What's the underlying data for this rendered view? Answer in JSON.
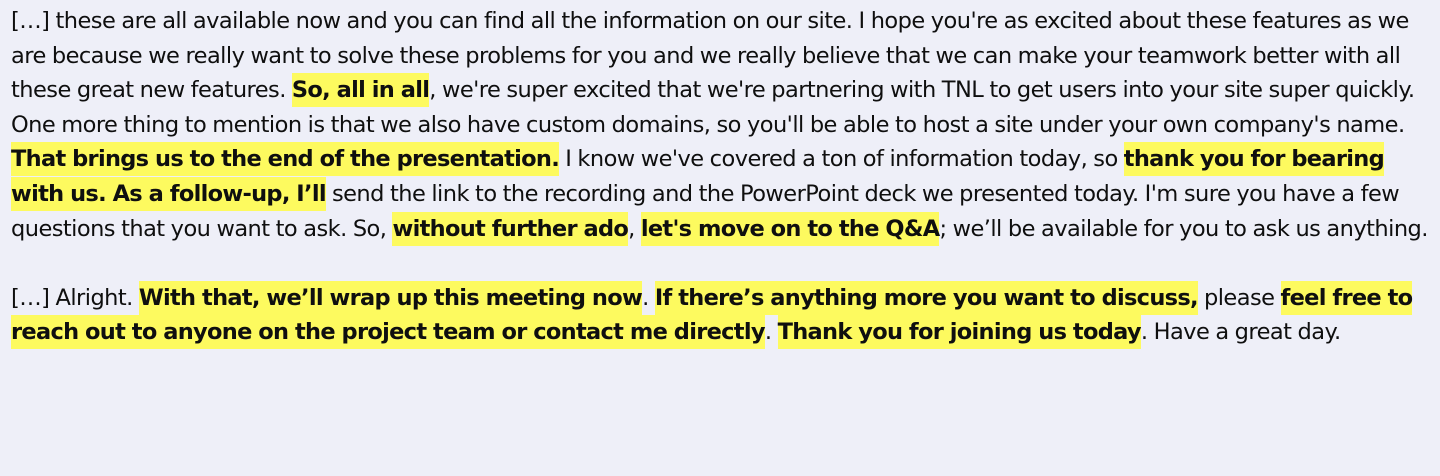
{
  "transcript": {
    "paragraphs": [
      {
        "segments": [
          {
            "text": "[…] these are all available now and you can find all the information on our site. I hope you're as excited about these features as we are because we really want to solve these problems for you and we really believe that we can make your teamwork better with all these great new features. ",
            "highlight": false
          },
          {
            "text": "So, all in all",
            "highlight": true
          },
          {
            "text": ", we're super excited that we're partnering with TNL to get users into your site super quickly. One more thing to mention is that we also have custom domains, so you'll be able to host a site under your own company's name. ",
            "highlight": false
          },
          {
            "text": "That brings us to the end of the presentation.",
            "highlight": true
          },
          {
            "text": " I know we've covered a ton of information today, so ",
            "highlight": false
          },
          {
            "text": "thank you for bearing with us. As a follow-up, I’ll",
            "highlight": true
          },
          {
            "text": " send the link to the recording and the PowerPoint deck we presented today. I'm sure you have a few questions that you want to ask. So, ",
            "highlight": false
          },
          {
            "text": "without further ado",
            "highlight": true
          },
          {
            "text": ", ",
            "highlight": false
          },
          {
            "text": "let's move on to the Q&A",
            "highlight": true
          },
          {
            "text": "; we’ll be available for you to ask us anything.",
            "highlight": false
          }
        ]
      },
      {
        "segments": [
          {
            "text": "[…] Alright. ",
            "highlight": false
          },
          {
            "text": "With that, we’ll wrap up this meeting now",
            "highlight": true
          },
          {
            "text": ". ",
            "highlight": false
          },
          {
            "text": "If there’s anything more you want to discuss,",
            "highlight": true
          },
          {
            "text": " please ",
            "highlight": false
          },
          {
            "text": "feel free to reach out to anyone on the project team or contact me directly",
            "highlight": true
          },
          {
            "text": ". ",
            "highlight": false
          },
          {
            "text": "Thank you for joining us today",
            "highlight": true
          },
          {
            "text": ". Have a great day.",
            "highlight": false
          }
        ]
      }
    ]
  },
  "colors": {
    "background": "#eeeff8",
    "highlight": "#fdfa5f",
    "text": "#0f0f0f"
  }
}
